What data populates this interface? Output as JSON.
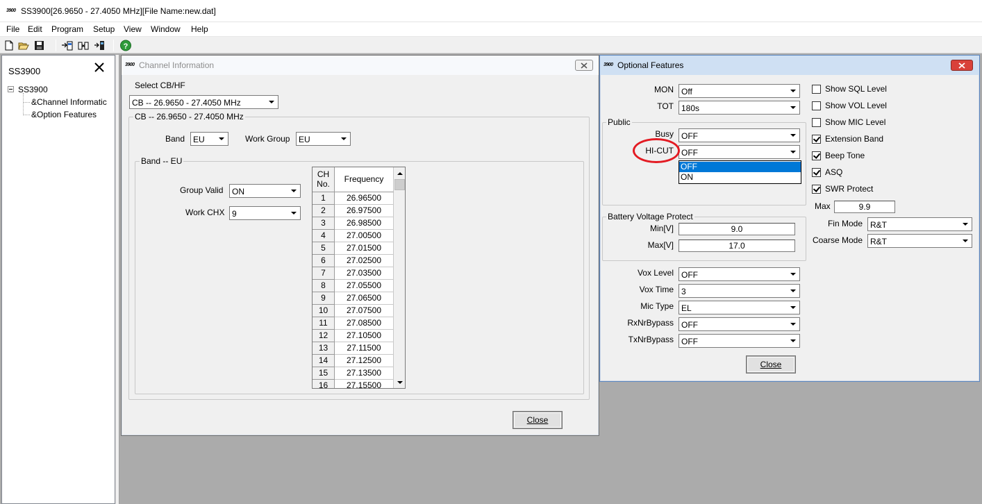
{
  "app": {
    "logo": "3900",
    "title": "SS3900[26.9650 - 27.4050 MHz][File Name:new.dat]"
  },
  "menu": [
    "File",
    "Edit",
    "Program",
    "Setup",
    "View",
    "Window",
    "Help"
  ],
  "toolbar": {
    "icons": [
      "new-file-icon",
      "open-folder-icon",
      "save-disk-icon",
      "read-from-radio-icon",
      "program-radio-icon",
      "write-to-radio-icon",
      "help-icon"
    ]
  },
  "tree": {
    "pane_title": "SS3900",
    "root": "SS3900",
    "items": [
      "&Channel Informatic",
      "&Option Features"
    ]
  },
  "channel_dialog": {
    "logo": "3900",
    "title": "Channel Information",
    "select_label": "Select CB/HF",
    "select_value": "CB -- 26.9650 - 27.4050 MHz",
    "group_label": "CB -- 26.9650 - 27.4050 MHz",
    "band_label": "Band",
    "band_value": "EU",
    "work_group_label": "Work Group",
    "work_group_value": "EU",
    "band_group_label": "Band -- EU",
    "group_valid_label": "Group Valid",
    "group_valid_value": "ON",
    "work_chx_label": "Work CHX",
    "work_chx_value": "9",
    "grid": {
      "col_no_line1": "CH",
      "col_no_line2": "No.",
      "col_freq": "Frequency",
      "rows": [
        {
          "no": "1",
          "freq": "26.96500"
        },
        {
          "no": "2",
          "freq": "26.97500"
        },
        {
          "no": "3",
          "freq": "26.98500"
        },
        {
          "no": "4",
          "freq": "27.00500"
        },
        {
          "no": "5",
          "freq": "27.01500"
        },
        {
          "no": "6",
          "freq": "27.02500"
        },
        {
          "no": "7",
          "freq": "27.03500"
        },
        {
          "no": "8",
          "freq": "27.05500"
        },
        {
          "no": "9",
          "freq": "27.06500"
        },
        {
          "no": "10",
          "freq": "27.07500"
        },
        {
          "no": "11",
          "freq": "27.08500"
        },
        {
          "no": "12",
          "freq": "27.10500"
        },
        {
          "no": "13",
          "freq": "27.11500"
        },
        {
          "no": "14",
          "freq": "27.12500"
        },
        {
          "no": "15",
          "freq": "27.13500"
        },
        {
          "no": "16",
          "freq": "27.15500"
        }
      ]
    },
    "close_label": "Close"
  },
  "options_dialog": {
    "logo": "3900",
    "title": "Optional Features",
    "mon_label": "MON",
    "mon_value": "Off",
    "tot_label": "TOT",
    "tot_value": "180s",
    "public_label": "Public",
    "busy_label": "Busy",
    "busy_value": "OFF",
    "hicut_label": "HI-CUT",
    "hicut_value": "OFF",
    "hicut_options": [
      "OFF",
      "ON"
    ],
    "battery_label": "Battery Voltage Protect",
    "min_label": "Min[V]",
    "min_value": "9.0",
    "max_label": "Max[V]",
    "max_value": "17.0",
    "vox_level_label": "Vox Level",
    "vox_level_value": "OFF",
    "vox_time_label": "Vox Time",
    "vox_time_value": "3",
    "mic_type_label": "Mic Type",
    "mic_type_value": "EL",
    "rxnr_label": "RxNrBypass",
    "rxnr_value": "OFF",
    "txnr_label": "TxNrBypass",
    "txnr_value": "OFF",
    "checks": [
      {
        "label": "Show SQL Level",
        "checked": false
      },
      {
        "label": "Show VOL Level",
        "checked": false
      },
      {
        "label": "Show MIC Level",
        "checked": false
      },
      {
        "label": "Extension Band",
        "checked": true
      },
      {
        "label": "Beep Tone",
        "checked": true
      },
      {
        "label": "ASQ",
        "checked": true
      },
      {
        "label": "SWR Protect",
        "checked": true
      }
    ],
    "swr_max_label": "Max",
    "swr_max_value": "9.9",
    "fin_mode_label": "Fin Mode",
    "fin_mode_value": "R&T",
    "coarse_mode_label": "Coarse Mode",
    "coarse_mode_value": "R&T",
    "close_label": "Close"
  },
  "colors": {
    "selection": "#0078d7",
    "annotation": "#e31b23",
    "workspace": "#ababab"
  }
}
